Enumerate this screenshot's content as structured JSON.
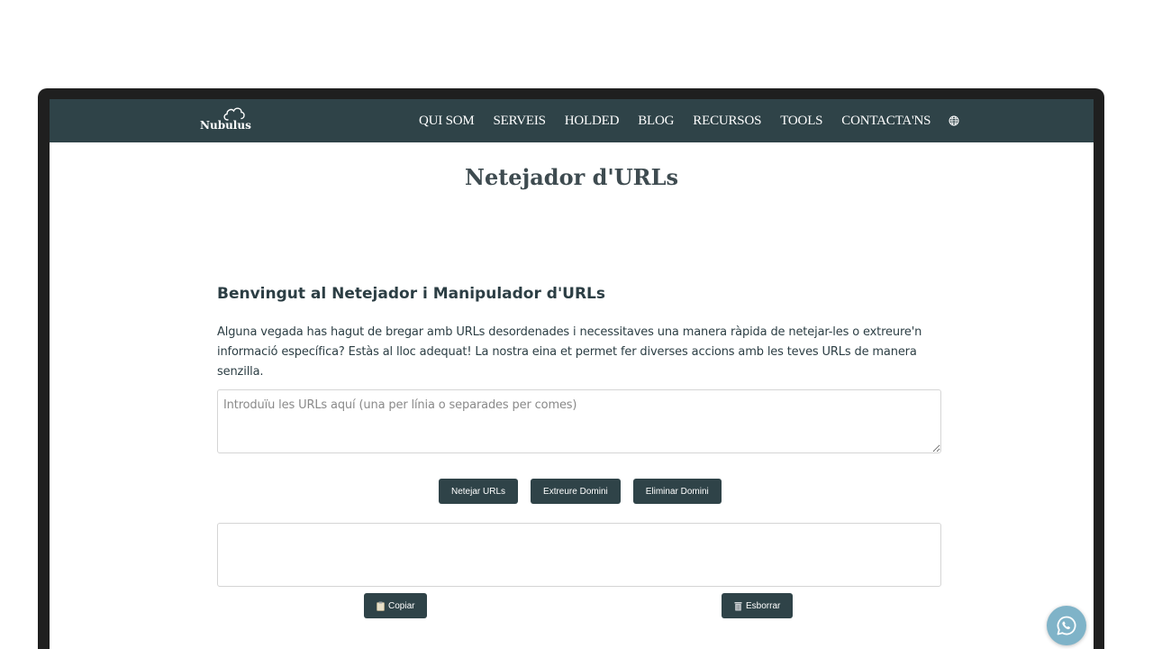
{
  "navbar": {
    "logo_text": "Nubulus",
    "items": [
      {
        "label": "QUI SOM"
      },
      {
        "label": "SERVEIS"
      },
      {
        "label": "HOLDED"
      },
      {
        "label": "BLOG"
      },
      {
        "label": "RECURSOS"
      },
      {
        "label": "TOOLS"
      },
      {
        "label": "CONTACTA'NS"
      }
    ],
    "language_icon": "globe-icon"
  },
  "page": {
    "title": "Netejador d'URLs"
  },
  "tool": {
    "heading": "Benvingut al Netejador i Manipulador d'URLs",
    "intro": "Alguna vegada has hagut de bregar amb URLs desordenades i necessitaves una manera ràpida de netejar-les o extreure'n informació específica? Estàs al lloc adequat! La nostra eina et permet fer diverses accions amb les teves URLs de manera senzilla.",
    "input": {
      "placeholder": "Introduïu les URLs aquí (una per línia o separades per comes)",
      "value": ""
    },
    "buttons": {
      "clean": "Netejar URLs",
      "extract": "Extreure Domini",
      "remove": "Eliminar Domini"
    },
    "output": {
      "value": ""
    },
    "copy_label": "Copiar",
    "clear_label": "Esborrar"
  },
  "floating": {
    "whatsapp_icon": "whatsapp-icon"
  },
  "colors": {
    "primary": "#2f4348",
    "text": "#2c3e44",
    "whatsapp_bg": "#7fb3c8",
    "frame": "#1f1f1f"
  }
}
